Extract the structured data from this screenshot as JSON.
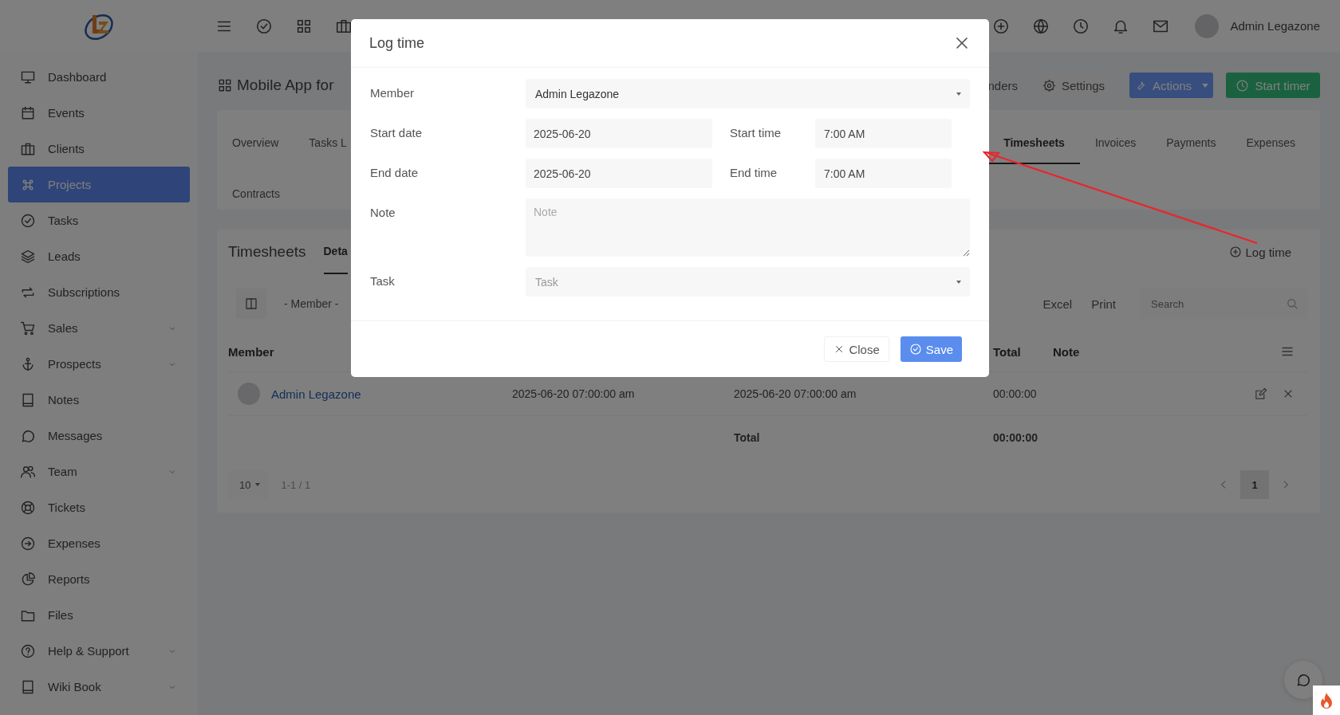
{
  "topbar": {
    "user_name": "Admin Legazone"
  },
  "sidebar": {
    "items": [
      {
        "label": "Dashboard",
        "selected": false,
        "has_submenu": false
      },
      {
        "label": "Events",
        "selected": false,
        "has_submenu": false
      },
      {
        "label": "Clients",
        "selected": false,
        "has_submenu": false
      },
      {
        "label": "Projects",
        "selected": true,
        "has_submenu": false
      },
      {
        "label": "Tasks",
        "selected": false,
        "has_submenu": false
      },
      {
        "label": "Leads",
        "selected": false,
        "has_submenu": false
      },
      {
        "label": "Subscriptions",
        "selected": false,
        "has_submenu": false
      },
      {
        "label": "Sales",
        "selected": false,
        "has_submenu": true
      },
      {
        "label": "Prospects",
        "selected": false,
        "has_submenu": true
      },
      {
        "label": "Notes",
        "selected": false,
        "has_submenu": false
      },
      {
        "label": "Messages",
        "selected": false,
        "has_submenu": false
      },
      {
        "label": "Team",
        "selected": false,
        "has_submenu": true
      },
      {
        "label": "Tickets",
        "selected": false,
        "has_submenu": false
      },
      {
        "label": "Expenses",
        "selected": false,
        "has_submenu": false
      },
      {
        "label": "Reports",
        "selected": false,
        "has_submenu": false
      },
      {
        "label": "Files",
        "selected": false,
        "has_submenu": false
      },
      {
        "label": "Help & Support",
        "selected": false,
        "has_submenu": true
      },
      {
        "label": "Wiki Book",
        "selected": false,
        "has_submenu": true
      }
    ]
  },
  "project": {
    "title": "Mobile App for",
    "buttons": [
      {
        "label": "nders",
        "kind": "plain"
      },
      {
        "label": "Settings",
        "kind": "settings"
      },
      {
        "label": "Actions",
        "kind": "dropdown"
      },
      {
        "label": "Start timer",
        "kind": "timer"
      }
    ]
  },
  "tabs": [
    {
      "label": "Overview",
      "selected": false
    },
    {
      "label": "Tasks L",
      "selected": false
    },
    {
      "label": "Timesheets",
      "selected": true
    },
    {
      "label": "Invoices",
      "selected": false
    },
    {
      "label": "Payments",
      "selected": false
    },
    {
      "label": "Expenses",
      "selected": false
    },
    {
      "label": "Contracts",
      "selected": false
    }
  ],
  "timesheets": {
    "title": "Timesheets",
    "tabs": [
      {
        "label": "Deta",
        "selected": true
      }
    ],
    "log_time_link": "Log time",
    "filter": "- Member -",
    "export_buttons": [
      "Excel",
      "Print"
    ],
    "search": {
      "placeholder": "Search"
    },
    "columns": {
      "member": "Member",
      "total": "Total",
      "note": "Note"
    },
    "rows": [
      {
        "member": "Admin Legazone",
        "start": "2025-06-20 07:00:00 am",
        "end": "2025-06-20 07:00:00 am",
        "total": "00:00:00"
      }
    ],
    "total_row": {
      "label": "Total",
      "value": "00:00:00"
    },
    "page_size": "10",
    "range": "1-1 / 1",
    "pages": [
      {
        "label": "1",
        "selected": true
      }
    ]
  },
  "modal": {
    "title": "Log time",
    "rows": [
      {
        "kind": "select",
        "label": "Member",
        "value": "Admin Legazone"
      },
      {
        "kind": "pair",
        "label": "Start date",
        "value": "2025-06-20",
        "label_2": "Start time",
        "value_2": "7:00 AM"
      },
      {
        "kind": "pair",
        "label": "End date",
        "value": "2025-06-20",
        "label_2": "End time",
        "value_2": "7:00 AM"
      },
      {
        "kind": "textarea",
        "label": "Note",
        "placeholder": "Note"
      },
      {
        "kind": "select",
        "label": "Task",
        "placeholder": "Task"
      }
    ],
    "buttons": [
      {
        "label": "Close",
        "kind": "secondary"
      },
      {
        "label": "Save",
        "kind": "primary"
      }
    ]
  }
}
